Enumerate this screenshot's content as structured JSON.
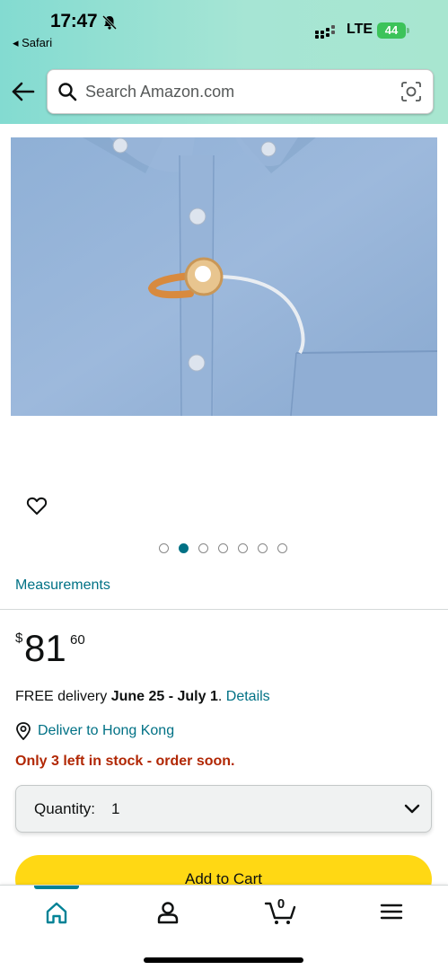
{
  "status_bar": {
    "time": "17:47",
    "back_app": "◂ Safari",
    "network": "LTE",
    "battery": "44"
  },
  "search": {
    "placeholder": "Search Amazon.com"
  },
  "carousel": {
    "total_images": 7,
    "active_index": 1
  },
  "product": {
    "measurements_link": "Measurements",
    "price_symbol": "$",
    "price_whole": "81",
    "price_fraction": "60",
    "delivery_prefix": "FREE delivery ",
    "delivery_dates": "June 25 - July 1",
    "delivery_sep": ". ",
    "delivery_details_link": "Details",
    "deliver_to": "Deliver to Hong Kong",
    "stock_message": "Only 3 left in stock - order soon.",
    "quantity_label": "Quantity:",
    "quantity_value": "1",
    "add_to_cart_label": "Add to Cart"
  },
  "bottom_nav": {
    "cart_count": "0"
  },
  "colors": {
    "header_gradient_start": "#83dbd1",
    "header_gradient_end": "#a8e6d0",
    "link": "#007185",
    "stock_red": "#b12704",
    "add_to_cart": "#ffd814",
    "nav_active": "#008296",
    "battery_green": "#3cc35a"
  }
}
